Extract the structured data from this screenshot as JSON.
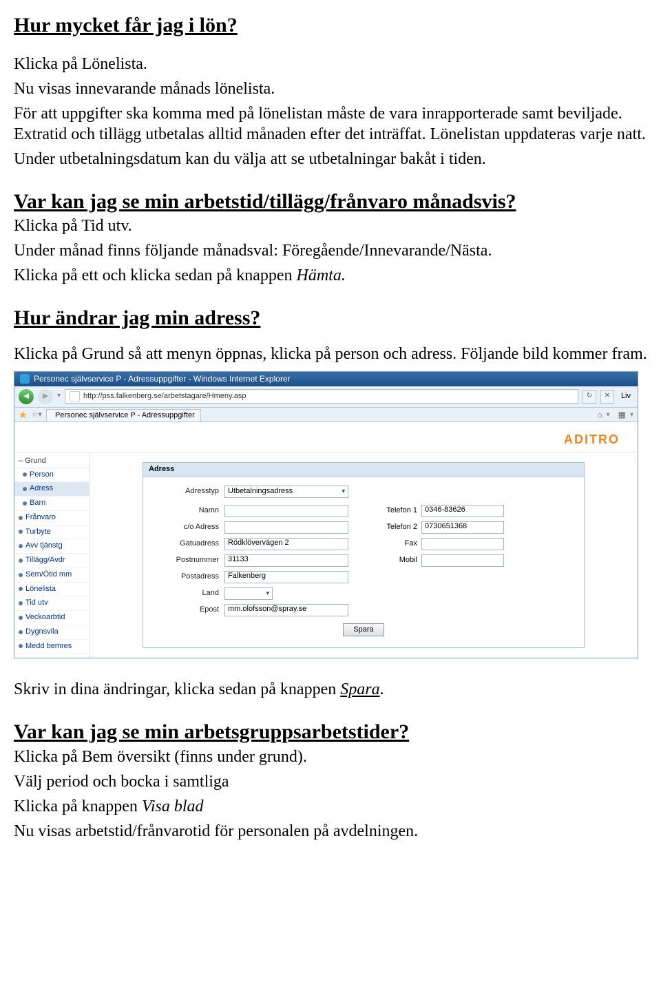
{
  "doc": {
    "h1": "Hur mycket får jag i lön?",
    "p1": "Klicka på Lönelista.",
    "p2": "Nu visas innevarande månads lönelista.",
    "p3": "För att uppgifter ska komma med på lönelistan måste de vara inrapporterade samt beviljade. Extratid och tillägg utbetalas alltid månaden efter det inträffat. Lönelistan uppdateras varje natt.",
    "p4": "Under utbetalningsdatum kan du välja att se utbetalningar bakåt i tiden.",
    "h2a": "Var kan jag se min arbetstid/tillägg/frånvaro månadsvis?",
    "p5": "Klicka på Tid utv.",
    "p6": "Under månad finns följande månadsval: Föregående/Innevarande/Nästa.",
    "p7_pre": "Klicka på ett och klicka sedan på knappen ",
    "p7_em": "Hämta.",
    "h2b": "Hur ändrar jag min adress?",
    "p8": "Klicka på Grund så att menyn öppnas, klicka på person och adress. Följande bild kommer fram.",
    "p9_pre": "Skriv in dina ändringar, klicka sedan på knappen ",
    "p9_em": "Spara",
    "p9_post": ".",
    "h2c": "Var kan jag se min arbetsgruppsarbetstider?",
    "p10": "Klicka på Bem översikt (finns under grund).",
    "p11": "Välj period och bocka i samtliga",
    "p12_pre": "Klicka på knappen ",
    "p12_em": "Visa blad",
    "p13": "Nu visas arbetstid/frånvarotid för personalen på avdelningen."
  },
  "shot": {
    "window_title": "Personec självservice P - Adressuppgifter - Windows Internet Explorer",
    "url": "http://pss.falkenberg.se/arbetstagare/Hmeny.asp",
    "tab": "Personec självservice P - Adressuppgifter",
    "live_label": "Liv",
    "logo": "ADITRO",
    "sidebar": {
      "header": "– Grund",
      "items": [
        "Person",
        "Adress",
        "Barn",
        "Frånvaro",
        "Turbyte",
        "Avv tjänstg",
        "Tillägg/Avdr",
        "Sem/Ötid mm",
        "Lönelista",
        "Tid utv",
        "Veckoarbtid",
        "Dygnsvila",
        "Medd bemres"
      ]
    },
    "panel": {
      "title": "Adress",
      "labels": {
        "adresstyp": "Adresstyp",
        "namn": "Namn",
        "co": "c/o Adress",
        "gatu": "Gatuadress",
        "postnr": "Postnummer",
        "postad": "Postadress",
        "land": "Land",
        "epost": "Epost",
        "tel1": "Telefon 1",
        "tel2": "Telefon 2",
        "fax": "Fax",
        "mobil": "Mobil"
      },
      "values": {
        "adresstyp_sel": "Utbetalningsadress",
        "namn": "",
        "co": "",
        "gatu": "Rödklövervägen 2",
        "postnr": "31133",
        "postad": "Falkenberg",
        "land": "",
        "epost": "mm.olofsson@spray.se",
        "tel1": "0346-83626",
        "tel2": "0730651368",
        "fax": "",
        "mobil": ""
      },
      "save_btn": "Spara"
    }
  }
}
